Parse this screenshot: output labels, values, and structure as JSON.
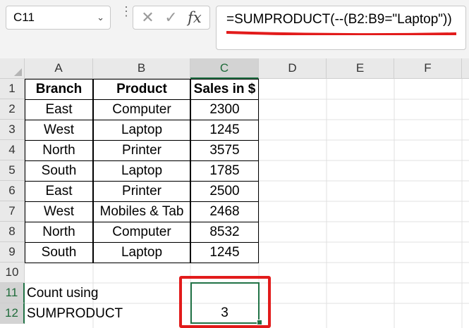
{
  "name_box": {
    "value": "C11",
    "dropdown_icon": "chevron-down-icon"
  },
  "formula_toolbar": {
    "cancel_icon": "cancel-icon",
    "enter_icon": "check-icon",
    "function_label": "fx"
  },
  "formula_bar": {
    "value": "=SUMPRODUCT(--(B2:B9=\"Laptop\"))"
  },
  "columns": [
    "A",
    "B",
    "C",
    "D",
    "E",
    "F"
  ],
  "rows": [
    "1",
    "2",
    "3",
    "4",
    "5",
    "6",
    "7",
    "8",
    "9",
    "10",
    "11",
    "12"
  ],
  "table": {
    "headers": [
      "Branch",
      "Product",
      "Sales in $"
    ],
    "rows": [
      [
        "East",
        "Computer",
        "2300"
      ],
      [
        "West",
        "Laptop",
        "1245"
      ],
      [
        "North",
        "Printer",
        "3575"
      ],
      [
        "South",
        "Laptop",
        "1785"
      ],
      [
        "East",
        "Printer",
        "2500"
      ],
      [
        "West",
        "Mobiles & Tab",
        "2468"
      ],
      [
        "North",
        "Computer",
        "8532"
      ],
      [
        "South",
        "Laptop",
        "1245"
      ]
    ]
  },
  "label": {
    "line1": "Count using",
    "line2": "SUMPRODUCT"
  },
  "result": {
    "value": "3"
  },
  "colors": {
    "selection": "#217346",
    "highlight": "#e21b1b",
    "header_bg": "#e9e9e9"
  }
}
